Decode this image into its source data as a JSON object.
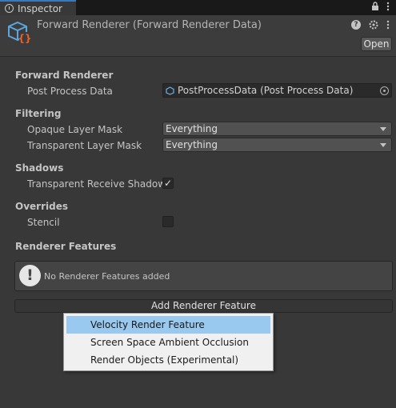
{
  "tab": {
    "label": "Inspector",
    "icon": "info-icon"
  },
  "header": {
    "title": "Forward Renderer (Forward Renderer Data)",
    "open_label": "Open",
    "icon": "renderer-asset-icon"
  },
  "forward_renderer": {
    "section_label": "Forward Renderer",
    "post_process_label": "Post Process Data",
    "post_process_value": "PostProcessData (Post Process Data)"
  },
  "filtering": {
    "section_label": "Filtering",
    "opaque_label": "Opaque Layer Mask",
    "opaque_value": "Everything",
    "transparent_label": "Transparent Layer Mask",
    "transparent_value": "Everything"
  },
  "shadows": {
    "section_label": "Shadows",
    "transparent_receive_label": "Transparent Receive Shadow",
    "transparent_receive_checked": true,
    "check_glyph": "✓"
  },
  "overrides": {
    "section_label": "Overrides",
    "stencil_label": "Stencil",
    "stencil_checked": false
  },
  "renderer_features": {
    "section_label": "Renderer Features",
    "empty_message": "No Renderer Features added",
    "add_button_label": "Add Renderer Feature"
  },
  "menu": {
    "items": [
      {
        "label": "Velocity Render Feature",
        "selected": true
      },
      {
        "label": "Screen Space Ambient Occlusion",
        "selected": false
      },
      {
        "label": "Render Objects (Experimental)",
        "selected": false
      }
    ]
  },
  "colors": {
    "background": "#383838",
    "accent": "#3a79bb",
    "menu_highlight": "#99c9ef"
  }
}
